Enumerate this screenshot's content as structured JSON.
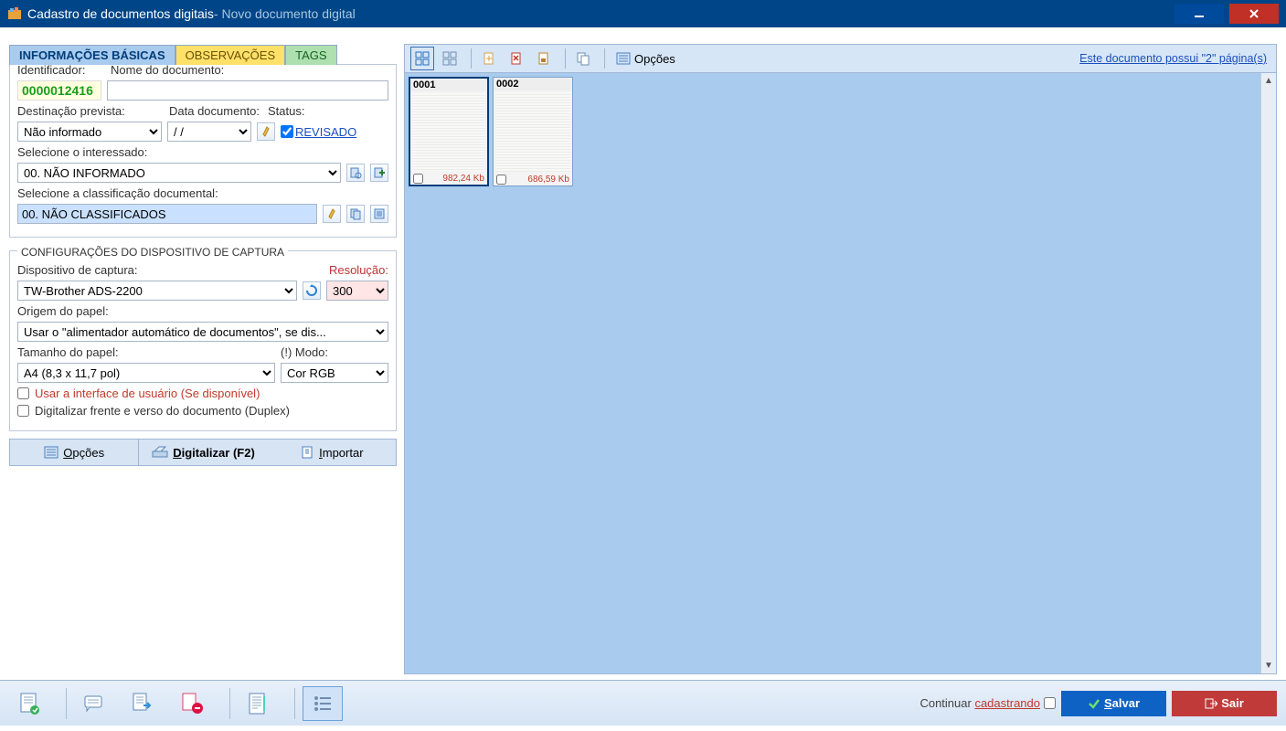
{
  "title": {
    "main": "Cadastro de documentos digitais",
    "sub": " - Novo documento digital"
  },
  "tabs": {
    "basic": "INFORMAÇÕES BÁSICAS",
    "obs": "OBSERVAÇÕES",
    "tags": "TAGS"
  },
  "fields": {
    "id_label": "Identificador:",
    "id_value": "0000012416",
    "docname_label": "Nome do documento:",
    "docname_value": "",
    "dest_label": "Destinação prevista:",
    "dest_value": "Não informado",
    "date_label": "Data documento:",
    "date_value": "  /  /",
    "status_label": "Status:",
    "status_value": "REVISADO",
    "interested_label": "Selecione o interessado:",
    "interested_value": "00. NÃO INFORMADO",
    "class_label": "Selecione a classificação documental:",
    "class_value": "00. NÃO CLASSIFICADOS"
  },
  "capture": {
    "legend": "CONFIGURAÇÕES DO DISPOSITIVO DE CAPTURA",
    "device_label": "Dispositivo de captura:",
    "device_value": "TW-Brother ADS-2200",
    "res_label": "Resolução:",
    "res_value": "300",
    "origin_label": "Origem do papel:",
    "origin_value": "Usar o \"alimentador automático de documentos\", se dis...",
    "size_label": "Tamanho do papel:",
    "size_value": "A4 (8,3 x 11,7 pol)",
    "mode_label": "(!) Modo:",
    "mode_value": "Cor RGB",
    "use_ui": "Usar a interface de usuário (Se disponível)",
    "duplex": "Digitalizar frente e verso do documento (Duplex)"
  },
  "capbtns": {
    "options": "Opções",
    "digitize": "Digitalizar (F2)",
    "import": "Importar"
  },
  "rightbar": {
    "options": "Opções",
    "pages_link": "Este documento possui \"2\" página(s)"
  },
  "thumbs": [
    {
      "num": "0001",
      "size": "982,24 Kb"
    },
    {
      "num": "0002",
      "size": "686,59 Kb"
    }
  ],
  "footer": {
    "continue_pre": "Continuar ",
    "continue_link": "cadastrando",
    "save": "Salvar",
    "exit": "Sair"
  }
}
